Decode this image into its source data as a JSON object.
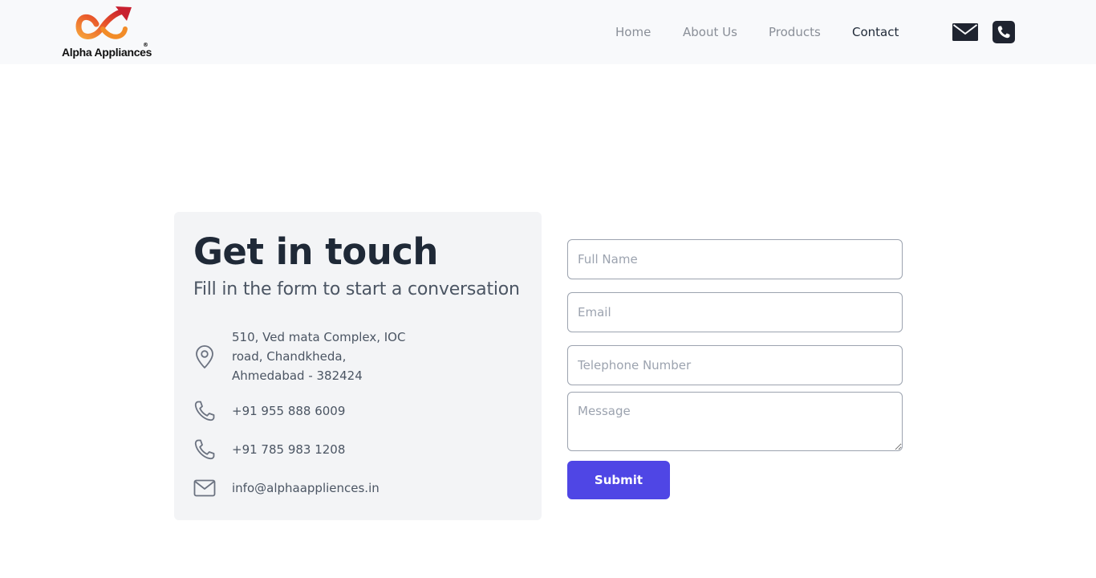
{
  "brand": {
    "name": "Alpha Appliances",
    "reg_mark": "®"
  },
  "nav": {
    "items": [
      {
        "label": "Home"
      },
      {
        "label": "About Us"
      },
      {
        "label": "Products"
      },
      {
        "label": "Contact"
      }
    ]
  },
  "header_icons": [
    "mail-icon",
    "phone-icon"
  ],
  "contact_info": {
    "title": "Get in touch",
    "subtitle": "Fill in the form to start a conversation",
    "address_lines": [
      "510, Ved mata Complex, IOC",
      "road, Chandkheda,",
      "Ahmedabad - 382424"
    ],
    "phone_1": "+91 955 888 6009",
    "phone_2": "+91 785 983 1208",
    "email": "info@alphaappliences.in"
  },
  "form": {
    "full_name_placeholder": "Full Name",
    "email_placeholder": "Email",
    "telephone_placeholder": "Telephone Number",
    "message_placeholder": "Message",
    "submit_label": "Submit"
  },
  "colors": {
    "accent": "#4f46e5",
    "header_bg": "#f8f9fb",
    "card_bg": "#f3f4f6",
    "logo_orange": "#f28c28",
    "logo_red": "#c8202f"
  }
}
